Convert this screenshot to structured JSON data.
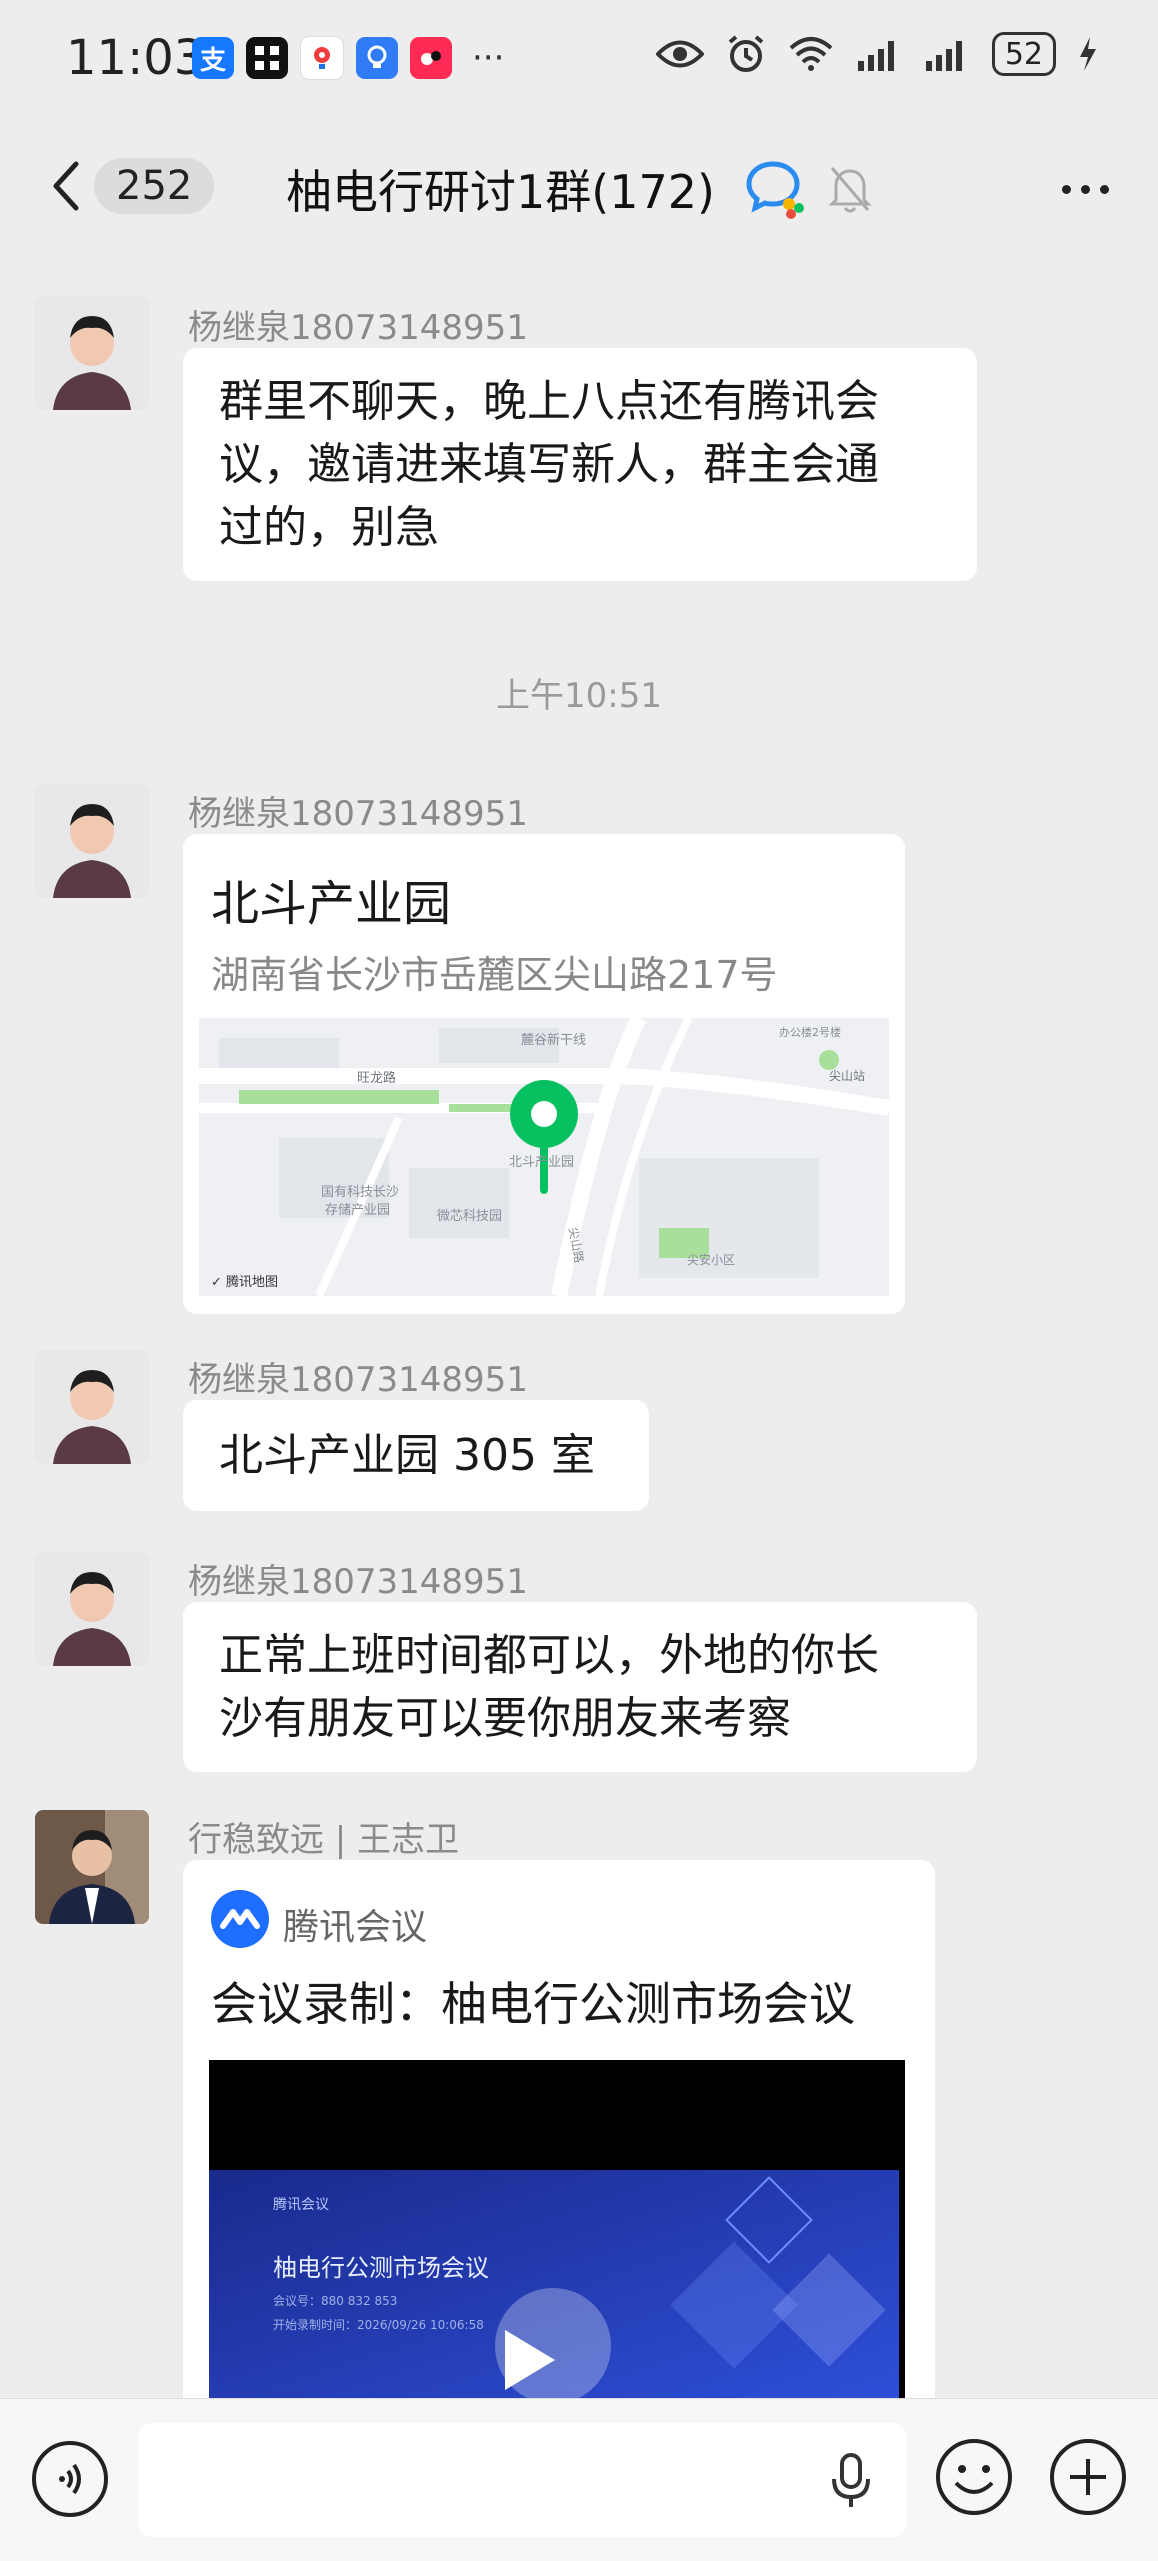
{
  "status_bar": {
    "time": "11:03",
    "app_icons": [
      "alipay-icon",
      "app-grid-icon",
      "map-app-icon",
      "bulb-app-icon",
      "douyin-icon"
    ],
    "overflow": "···",
    "battery": "52"
  },
  "header": {
    "unread_count": "252",
    "title": "柚电行研讨1群(172)"
  },
  "messages": [
    {
      "sender": "杨继泉18073148951",
      "text": "群里不聊天，晚上八点还有腾讯会\n议，邀请进来填写新人，群主会通\n过的，别急"
    },
    {
      "timestamp": "上午10:51"
    },
    {
      "sender": "杨继泉18073148951",
      "location": {
        "name": "北斗产业园",
        "address": "湖南省长沙市岳麓区尖山路217号",
        "map_labels": [
          "麓谷新干线",
          "旺龙路",
          "北斗产业园",
          "国有科技长沙\n存储产业园",
          "微芯科技园",
          "尖山路",
          "尖山站",
          "办公楼2号楼",
          "尖安小区",
          "腾讯地图"
        ]
      }
    },
    {
      "sender": "杨继泉18073148951",
      "text": "北斗产业园 305 室"
    },
    {
      "sender": "杨继泉18073148951",
      "text": "正常上班时间都可以，外地的你长\n沙有朋友可以要你朋友来考察"
    },
    {
      "sender": "行稳致远 | 王志卫",
      "meeting": {
        "app_name": "腾讯会议",
        "title": "会议录制：柚电行公测市场会议",
        "video_brand": "腾讯会议",
        "video_title": "柚电行公测市场会议",
        "video_line1": "会议号：880 832 853",
        "video_line2": "开始录制时间：2026/09/26 10:06:58"
      }
    }
  ],
  "input_bar": {
    "placeholder": ""
  },
  "colors": {
    "background": "#ededed",
    "bubble": "#ffffff",
    "accent_green": "#07c160",
    "meeting_blue": "#1e6fff"
  }
}
